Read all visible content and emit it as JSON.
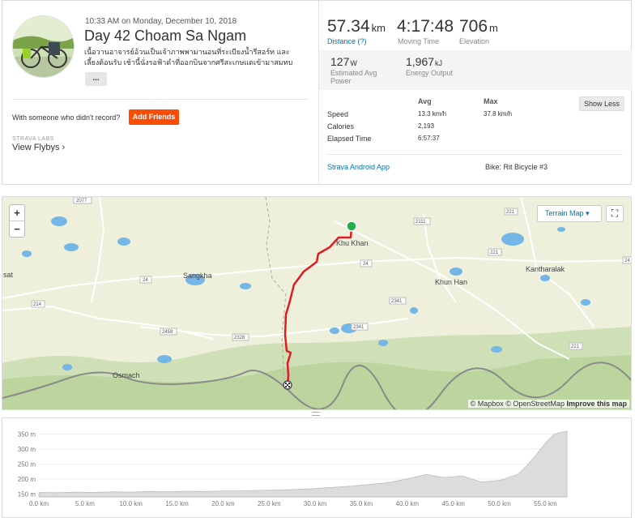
{
  "activity": {
    "timestamp": "10:33 AM on Monday, December 10, 2018",
    "title": "Day 42 Choam Sa Ngam",
    "description": "เนื้อวานอาจารย์อ้วนเป็นเจ้าภาพพามานอนที่ระเบียงน้ำรีสอร์ท และเลี้ยงต้อนรับ เช้านี้นั่งรอฟ้าดำที่ออกบินจากศรีสะเกษแดเข้ามาสมทบ",
    "more_label": "..."
  },
  "friends": {
    "question": "With someone who didn't record?",
    "button": "Add Friends"
  },
  "flybys": {
    "labs": "STRAVA LABS",
    "link": "View Flybys ›"
  },
  "stats": {
    "distance": {
      "value": "57.34",
      "unit": "km",
      "label": "Distance (?)"
    },
    "moving_time": {
      "value": "4:17:48",
      "label": "Moving Time"
    },
    "elevation": {
      "value": "706",
      "unit": "m",
      "label": "Elevation"
    },
    "power": {
      "value": "127",
      "unit": "W",
      "label": "Estimated Avg Power"
    },
    "energy": {
      "value": "1,967",
      "unit": "kJ",
      "label": "Energy Output"
    }
  },
  "details": {
    "avg_header": "Avg",
    "max_header": "Max",
    "show_less": "Show Less",
    "rows": [
      {
        "label": "Speed",
        "avg": "13.3 km/h",
        "max": "37.8 km/h"
      },
      {
        "label": "Calories",
        "avg": "2,193",
        "max": ""
      },
      {
        "label": "Elapsed Time",
        "avg": "6:57:37",
        "max": ""
      }
    ],
    "device": "Strava Android App",
    "bike": "Bike: Rit Bicycle #3"
  },
  "map": {
    "zoom_in": "+",
    "zoom_out": "−",
    "style_label": "Terrain Map ▾",
    "expand_icon": "⛶",
    "attribution_prefix": "© Mapbox © OpenStreetMap",
    "attribution_link": "Improve this map",
    "route_color": "#e11b22",
    "start_color": "#22b04b",
    "places": {
      "p1": "Khu Khan",
      "p2": "Sangkha",
      "p3": "Khun Han",
      "p4": "Kantharalak",
      "p5": "Osmach",
      "p6": "sat"
    },
    "roads": {
      "r1": "2077",
      "r2": "2111",
      "r3": "24",
      "r4": "24",
      "r5": "214",
      "r6": "2458",
      "r7": "2328",
      "r8": "2341",
      "r9": "2341",
      "r10": "221",
      "r11": "221",
      "r12": "221",
      "r13": "24"
    }
  },
  "elevation_chart": {
    "y_labels": [
      "350 m",
      "300 m",
      "250 m",
      "200 m",
      "150 m"
    ],
    "x_labels": [
      "0.0 km",
      "5.0 km",
      "10.0 km",
      "15.0 km",
      "20.0 km",
      "25.0 km",
      "30.0 km",
      "35.0 km",
      "40.0 km",
      "45.0 km",
      "50.0 km",
      "55.0 km"
    ]
  },
  "chart_data": {
    "type": "area",
    "title": "",
    "xlabel": "",
    "ylabel": "",
    "xlim": [
      0,
      57.34
    ],
    "ylim": [
      140,
      370
    ],
    "x": [
      0,
      2,
      4,
      6,
      8,
      10,
      12,
      14,
      16,
      18,
      20,
      22,
      24,
      26,
      28,
      30,
      32,
      34,
      36,
      38,
      40,
      42,
      44,
      46,
      48,
      50,
      52,
      53,
      54,
      55,
      56,
      57.34
    ],
    "y": [
      155,
      154,
      156,
      155,
      157,
      156,
      158,
      157,
      159,
      158,
      160,
      160,
      162,
      163,
      165,
      168,
      172,
      176,
      182,
      188,
      200,
      215,
      205,
      210,
      190,
      195,
      215,
      245,
      280,
      320,
      350,
      360
    ]
  }
}
